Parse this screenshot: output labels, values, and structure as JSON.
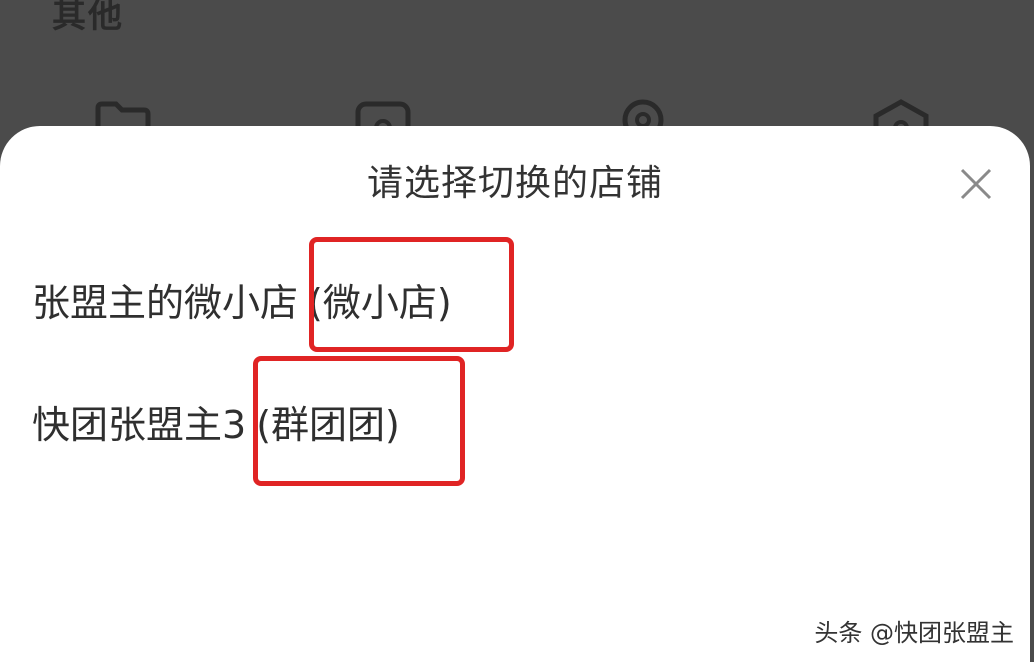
{
  "background": {
    "section_title": "其他",
    "icons": [
      "folder-icon",
      "card-icon",
      "location-icon",
      "shield-icon"
    ]
  },
  "dialog": {
    "title": "请选择切换的店铺",
    "close_icon": "close-icon",
    "stores": [
      {
        "name": "张盟主的微小店",
        "type": "(微小店)"
      },
      {
        "name": "快团张盟主3",
        "type": "(群团团)"
      }
    ]
  },
  "annotation": {
    "highlight_color": "#e02424"
  },
  "watermark": "头条 @快团张盟主"
}
